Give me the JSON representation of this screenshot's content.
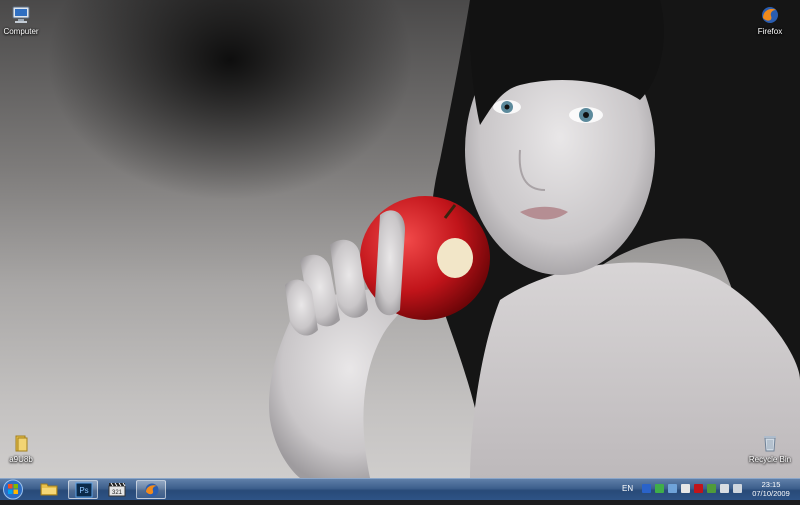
{
  "desktop": {
    "icons": [
      {
        "label": "Computer",
        "icon": "computer-icon"
      },
      {
        "label": "Firefox",
        "icon": "firefox-icon"
      },
      {
        "label": "a9U8b",
        "icon": "folder-icon"
      },
      {
        "label": "Recycle Bin",
        "icon": "recycle-bin-icon"
      }
    ]
  },
  "taskbar": {
    "pinned": [
      {
        "name": "Windows Explorer",
        "icon": "folder-icon"
      },
      {
        "name": "Adobe Photoshop",
        "icon": "photoshop-icon",
        "text": "Ps"
      },
      {
        "name": "Media Player Classic",
        "icon": "clapperboard-icon",
        "text": "321"
      },
      {
        "name": "Firefox",
        "icon": "firefox-icon"
      }
    ],
    "tray": {
      "language": "EN",
      "icons": [
        "bluetooth-icon",
        "messenger-icon",
        "network-icon",
        "flag-icon",
        "antivirus-icon",
        "shield-icon",
        "display-icon",
        "volume-icon"
      ],
      "time": "23:15",
      "date": "07/10/2009"
    }
  },
  "colors": {
    "taskbar": "#2e5386",
    "accent_red": "#c1141a"
  }
}
